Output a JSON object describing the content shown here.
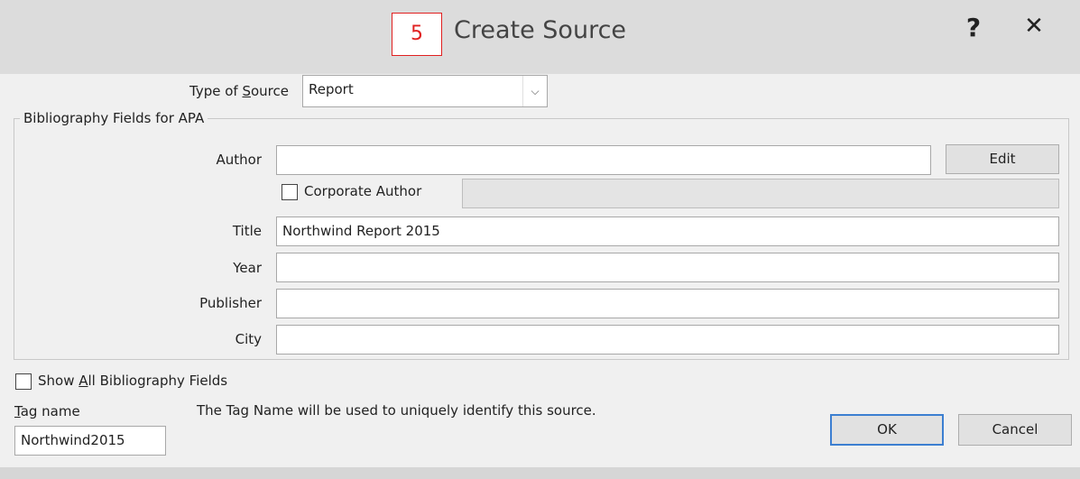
{
  "dialog": {
    "title": "Create Source",
    "step_badge": "5",
    "help_label": "?",
    "close_label": "✕"
  },
  "type_of_source": {
    "label": "Type of Source",
    "value": "Report"
  },
  "group": {
    "label": "Bibliography Fields for APA"
  },
  "fields": {
    "author_label": "Author",
    "author_value": "",
    "edit_label": "Edit",
    "corporate_label": "Corporate Author",
    "corporate_checked": false,
    "corporate_value": "",
    "title_label": "Title",
    "title_value": "Northwind Report 2015",
    "year_label": "Year",
    "year_value": "",
    "publisher_label": "Publisher",
    "publisher_value": "",
    "city_label": "City",
    "city_value": ""
  },
  "footer": {
    "show_all_label": "Show All Bibliography Fields",
    "show_all_checked": false,
    "tag_label": "Tag name",
    "tag_value": "Northwind2015",
    "tag_note": "The Tag Name will be used to uniquely identify this source.",
    "ok_label": "OK",
    "cancel_label": "Cancel"
  },
  "colors": {
    "badge_border": "#e02020",
    "default_button_border": "#3c7fd1"
  }
}
